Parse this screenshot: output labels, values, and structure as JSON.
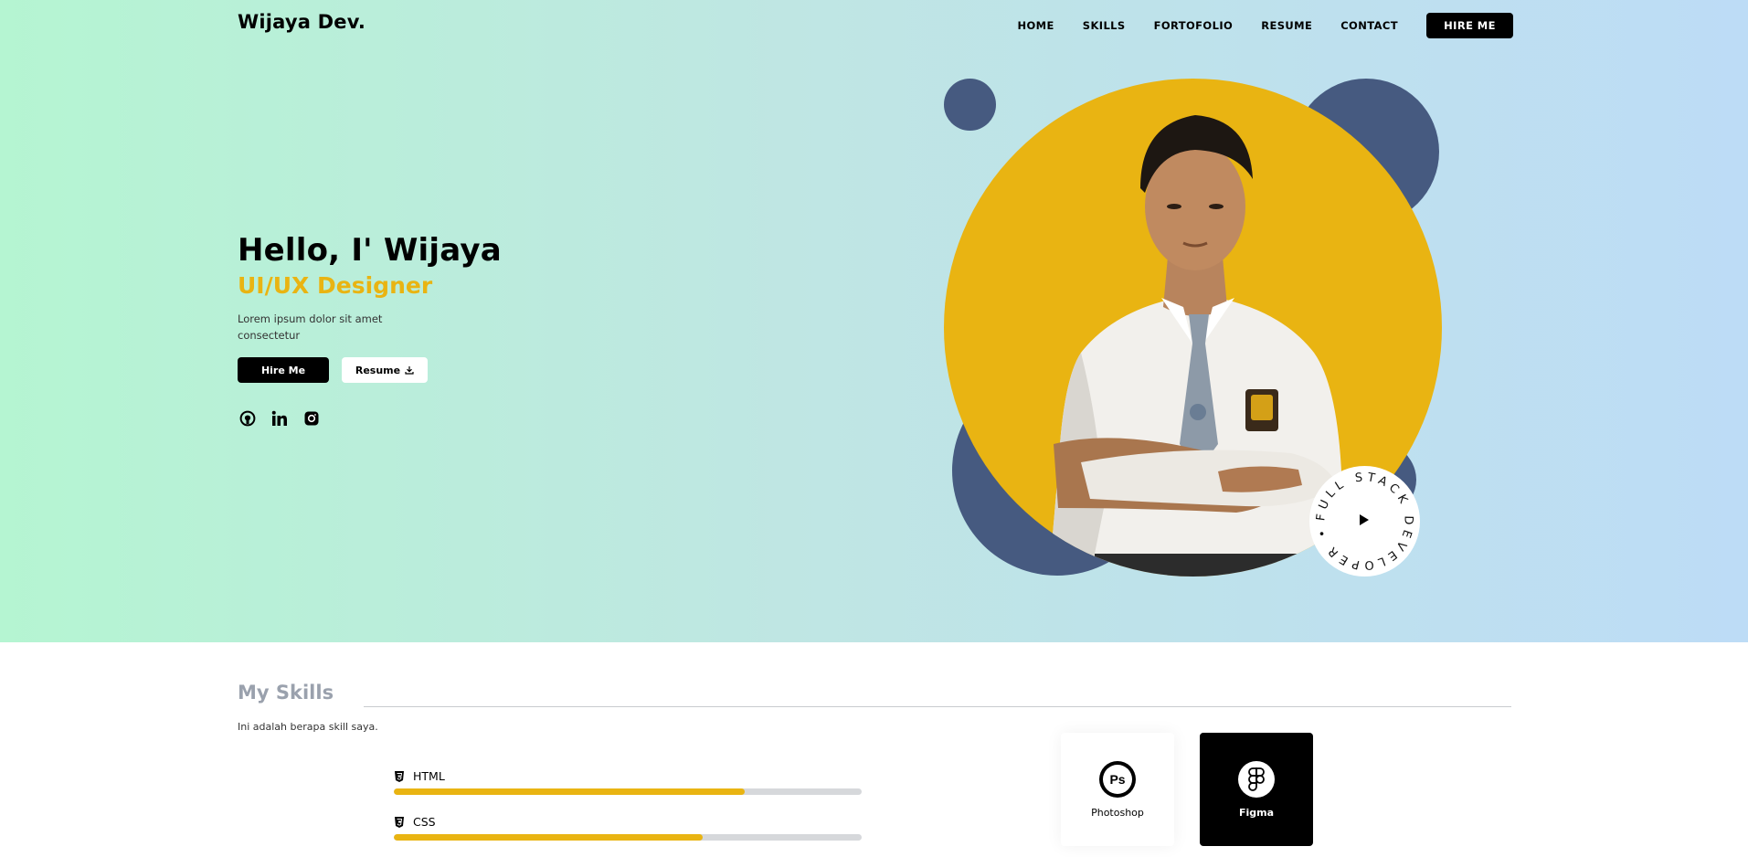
{
  "brand": {
    "logo": "Wijaya Dev."
  },
  "nav": {
    "links": [
      "HOME",
      "SKILLS",
      "FORTOFOLIO",
      "RESUME",
      "CONTACT"
    ],
    "cta": "HIRE ME"
  },
  "hero": {
    "title": "Hello, I' Wijaya",
    "role": "UI/UX Designer",
    "description": "Lorem ipsum dolor sit amet consectetur",
    "hire_button": "Hire Me",
    "resume_button": "Resume",
    "socials": [
      "github-icon",
      "linkedin-icon",
      "instagram-icon"
    ],
    "badge_text": "FULL STACK DEVELOPER •"
  },
  "skills": {
    "title": "My Skills",
    "subtitle": "Ini adalah berapa skill saya.",
    "items": [
      {
        "name": "HTML",
        "icon": "html5-icon",
        "level": 0.75
      },
      {
        "name": "CSS",
        "icon": "css3-icon",
        "level": 0.66
      }
    ],
    "tools": [
      {
        "name": "Photoshop",
        "icon": "photoshop-icon"
      },
      {
        "name": "Figma",
        "icon": "figma-icon"
      }
    ]
  },
  "colors": {
    "accent": "#e9b412",
    "blob": "#465a80",
    "gradient_start": "#b5f5d2",
    "gradient_end": "#bddcf6"
  }
}
